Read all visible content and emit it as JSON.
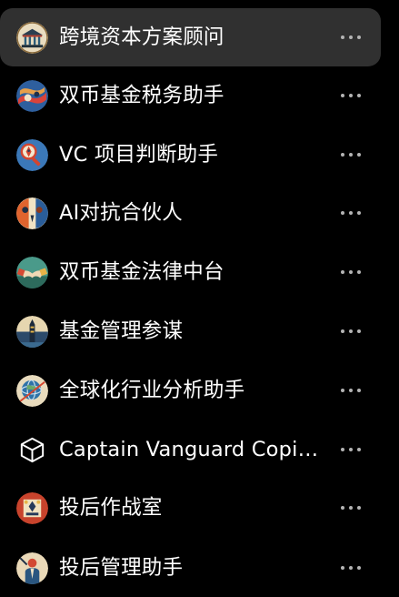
{
  "items": [
    {
      "label": "跨境资本方案顾问",
      "icon": "bank-building-avatar-icon",
      "active": true
    },
    {
      "label": "双币基金税务助手",
      "icon": "abstract-currency-avatar-icon",
      "active": false
    },
    {
      "label": "VC 项目判断助手",
      "icon": "rocket-magnifier-avatar-icon",
      "active": false
    },
    {
      "label": "AI对抗合伙人",
      "icon": "two-figures-avatar-icon",
      "active": false
    },
    {
      "label": "双币基金法律中台",
      "icon": "handshake-avatar-icon",
      "active": false
    },
    {
      "label": "基金管理参谋",
      "icon": "tower-avatar-icon",
      "active": false
    },
    {
      "label": "全球化行业分析助手",
      "icon": "globe-avatar-icon",
      "active": false
    },
    {
      "label": "Captain Vanguard Copilot",
      "icon": "cube-icon",
      "active": false
    },
    {
      "label": "投后作战室",
      "icon": "war-room-avatar-icon",
      "active": false
    },
    {
      "label": "投后管理助手",
      "icon": "figure-avatar-icon",
      "active": false
    }
  ],
  "colors": {
    "background": "#000000",
    "active_row": "#303030",
    "text": "#ffffff",
    "more_dots": "#b4b4b4"
  }
}
